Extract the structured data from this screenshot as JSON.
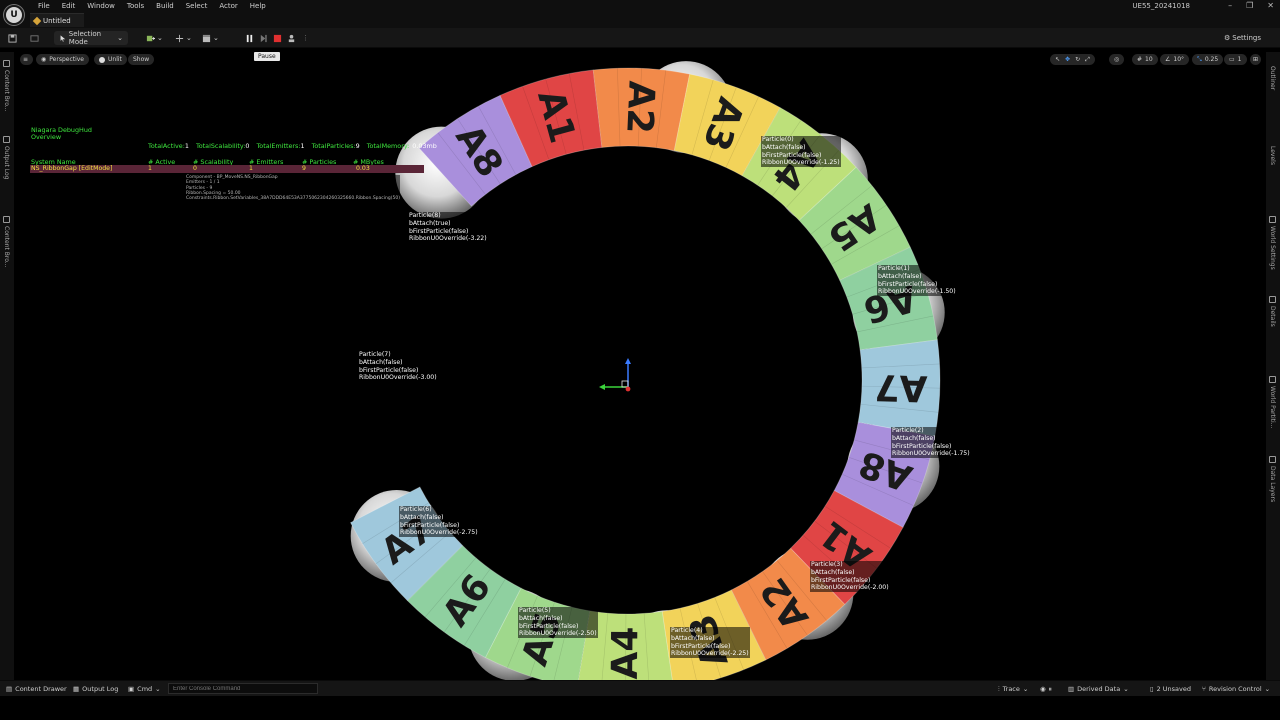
{
  "app": {
    "tab_title": "Untitled",
    "build": "UE55_20241018",
    "menu": [
      "File",
      "Edit",
      "Window",
      "Tools",
      "Build",
      "Select",
      "Actor",
      "Help"
    ]
  },
  "toolbar": {
    "selection_mode": "Selection Mode",
    "settings": "Settings",
    "pause_tooltip": "Pause"
  },
  "viewport_bar": {
    "perspective": "Perspective",
    "unlit": "Unlit",
    "show": "Show",
    "grid_value": "10",
    "rot_value": "10°",
    "scale_value": "0.25",
    "cam_value": "1"
  },
  "left_rail": [
    "Content Bro...",
    "Output Log",
    "Content Bro..."
  ],
  "right_rail": [
    "Outliner",
    "Levels",
    "World Settings",
    "Details",
    "World Partiti...",
    "Data Layers"
  ],
  "hud": {
    "title": "Niagara DebugHud",
    "overview": "Overview",
    "totals": [
      {
        "label": "TotalActive:",
        "value": "1"
      },
      {
        "label": "TotalScalability:",
        "value": "0"
      },
      {
        "label": "TotalEmitters:",
        "value": "1"
      },
      {
        "label": "TotalParticles:",
        "value": "9"
      },
      {
        "label": "TotalMemory:",
        "value": "0.03mb"
      }
    ],
    "columns": [
      "System Name",
      "# Active",
      "# Scalability",
      "# Emitters",
      "# Particles",
      "# MBytes"
    ],
    "row": [
      "NS_RibbonGap [EditMode]",
      "1",
      "0",
      "1",
      "9",
      "0.03"
    ],
    "component_lines": [
      "Component - BP_MoveNS.NS_RibbonGap",
      "Emitters - 1 / 1",
      "Particles - 9",
      "Ribbon.Spacing = 50.00",
      "Constraints.Ribbon.SetVariables_38A7DDD64E53A3775062304260325660.Ribbon.Spacing(50)"
    ]
  },
  "ribbon_segments": [
    "A8",
    "A1",
    "A2",
    "A3",
    "A4",
    "A5",
    "A6",
    "A7",
    "A8",
    "A1",
    "A2",
    "A3",
    "A4",
    "A5",
    "A6",
    "A7"
  ],
  "particles": [
    {
      "lines": [
        "Particle(0)",
        "bAttach(false)",
        "bFirstParticle(false)",
        "RibbonU0Override(-1.25)"
      ]
    },
    {
      "lines": [
        "Particle(1)",
        "bAttach(false)",
        "bFirstParticle(false)",
        "RibbonU0Override(-1.50)"
      ]
    },
    {
      "lines": [
        "Particle(2)",
        "bAttach(false)",
        "bFirstParticle(false)",
        "RibbonU0Override(-1.75)"
      ]
    },
    {
      "lines": [
        "Particle(3)",
        "bAttach(false)",
        "bFirstParticle(false)",
        "RibbonU0Override(-2.00)"
      ]
    },
    {
      "lines": [
        "Particle(4)",
        "bAttach(false)",
        "bFirstParticle(false)",
        "RibbonU0Override(-2.25)"
      ]
    },
    {
      "lines": [
        "Particle(5)",
        "bAttach(false)",
        "bFirstParticle(false)",
        "RibbonU0Override(-2.50)"
      ]
    },
    {
      "lines": [
        "Particle(6)",
        "bAttach(false)",
        "bFirstParticle(false)",
        "RibbonU0Override(-2.75)"
      ]
    },
    {
      "lines": [
        "Particle(7)",
        "bAttach(false)",
        "bFirstParticle(false)",
        "RibbonU0Override(-3.00)"
      ]
    },
    {
      "lines": [
        "Particle(8)",
        "bAttach(true)",
        "bFirstParticle(false)",
        "RibbonU0Override(-3.22)"
      ]
    }
  ],
  "statusbar": {
    "content_drawer": "Content Drawer",
    "output_log": "Output Log",
    "cmd": "Cmd",
    "console_placeholder": "Enter Console Command",
    "trace": "Trace",
    "derived_data": "Derived Data",
    "unsaved": "2 Unsaved",
    "revision_control": "Revision Control"
  },
  "colors": {
    "A1": "#e04545",
    "A2": "#f28a4a",
    "A3": "#f2d35a",
    "A4": "#bde07a",
    "A5": "#9fd88c",
    "A6": "#8fd0a0",
    "A7": "#9fc8dc",
    "A8": "#a98fdc"
  }
}
